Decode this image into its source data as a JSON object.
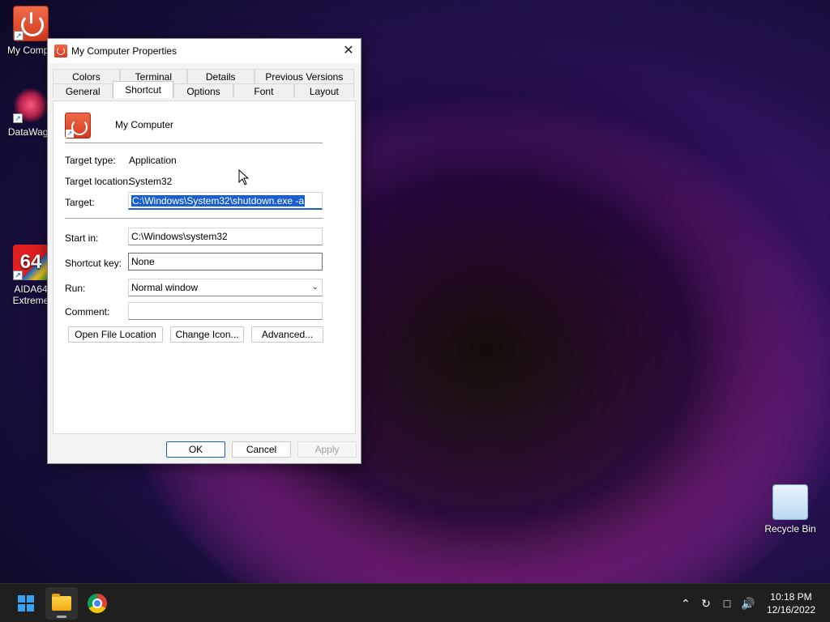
{
  "desktop": {
    "icons": [
      {
        "label": "My Compu"
      },
      {
        "label": "DataWago"
      },
      {
        "label": "AIDA64 Extreme"
      },
      {
        "label": "Recycle Bin"
      }
    ],
    "aida_glyph": "64"
  },
  "dialog": {
    "title": "My Computer Properties",
    "close_glyph": "✕",
    "tabs_row1": [
      "Colors",
      "Terminal",
      "Details",
      "Previous Versions"
    ],
    "tabs_row2": [
      "General",
      "Shortcut",
      "Options",
      "Font",
      "Layout"
    ],
    "active_tab": "Shortcut",
    "shortcut_name": "My Computer",
    "labels": {
      "target_type": "Target type:",
      "target_location": "Target location:",
      "target": "Target:",
      "start_in": "Start in:",
      "shortcut_key": "Shortcut key:",
      "run": "Run:",
      "comment": "Comment:"
    },
    "values": {
      "target_type": "Application",
      "target_location": "System32",
      "target": "C:\\Windows\\System32\\shutdown.exe -a",
      "start_in": "C:\\Windows\\system32",
      "shortcut_key": "None",
      "run": "Normal window",
      "comment": ""
    },
    "buttons": {
      "open_file_location": "Open File Location",
      "change_icon": "Change Icon...",
      "advanced": "Advanced...",
      "ok": "OK",
      "cancel": "Cancel",
      "apply": "Apply"
    }
  },
  "taskbar": {
    "clock_time": "10:18 PM",
    "clock_date": "12/16/2022",
    "tray_icons": [
      "chevron-up-icon",
      "sync-icon",
      "network-icon",
      "volume-icon"
    ]
  },
  "colors": {
    "accent": "#1a5fd0",
    "taskbar": "#1f1f1f"
  }
}
